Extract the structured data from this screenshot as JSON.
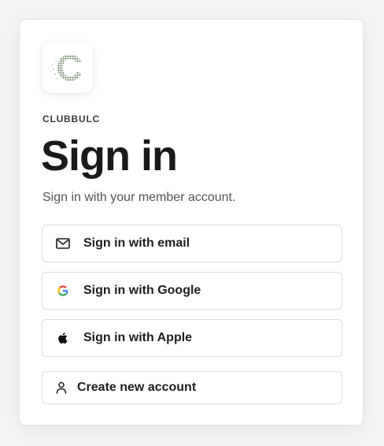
{
  "brand": {
    "name": "CLUBBULC",
    "logo_icon": "clubbulc-logo-icon",
    "logo_letter": "C"
  },
  "page": {
    "title": "Sign in",
    "subtitle": "Sign in with your member account."
  },
  "buttons": [
    {
      "label": "Sign in with email",
      "icon": "mail-icon"
    },
    {
      "label": "Sign in with Google",
      "icon": "google-icon"
    },
    {
      "label": "Sign in with Apple",
      "icon": "apple-icon"
    },
    {
      "label": "Create new account",
      "icon": "user-icon"
    }
  ],
  "colors": {
    "background": "#f4f4f4",
    "card": "#ffffff",
    "border": "#dcdcdc",
    "text": "#1a1a1a",
    "logo_green": "#7a8f74"
  }
}
